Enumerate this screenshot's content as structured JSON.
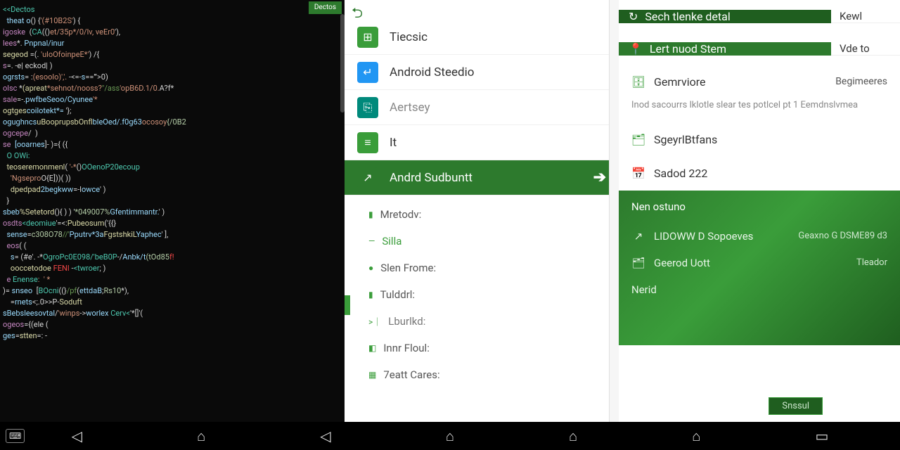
{
  "code": {
    "tab": "Dectos",
    "lines": [
      {
        "segs": [
          {
            "t": "<<Dectos",
            "c": "c-type"
          },
          {
            "t": " ",
            "c": ""
          }
        ]
      },
      {
        "segs": [
          {
            "t": "  theat o",
            "c": "c-var"
          },
          {
            "t": "() {",
            "c": "c-punc"
          },
          {
            "t": "'(#10B2S'",
            "c": "c-str"
          },
          {
            "t": ") {",
            "c": "c-punc"
          }
        ]
      },
      {
        "segs": [
          {
            "t": "igoske",
            "c": "c-kw"
          },
          {
            "t": "  (",
            "c": "c-punc"
          },
          {
            "t": "CA",
            "c": "c-type"
          },
          {
            "t": "(()",
            "c": "c-punc"
          },
          {
            "t": "et/35p*/0/lv, veEr0",
            "c": "c-str"
          },
          {
            "t": "'),",
            "c": "c-punc"
          }
        ]
      },
      {
        "segs": [
          {
            "t": "lees",
            "c": "c-kw"
          },
          {
            "t": "*. ",
            "c": "c-op"
          },
          {
            "t": "Pnpnal/inur",
            "c": "c-var"
          }
        ]
      },
      {
        "segs": [
          {
            "t": "segeod",
            "c": "c-fn"
          },
          {
            "t": " =(. ",
            "c": "c-op"
          },
          {
            "t": "'uloOfoinpeE*'",
            "c": "c-str"
          },
          {
            "t": ") /{",
            "c": "c-punc"
          }
        ]
      },
      {
        "segs": [
          {
            "t": "s",
            "c": "c-kw"
          },
          {
            "t": "=. -e| eckod| )",
            "c": "c-punc"
          }
        ]
      },
      {
        "segs": [
          {
            "t": "ogrsts",
            "c": "c-var"
          },
          {
            "t": "= :",
            "c": "c-op"
          },
          {
            "t": "(esoolo)','.",
            "c": "c-str"
          },
          {
            "t": " -<=-",
            "c": "c-op"
          },
          {
            "t": "s",
            "c": "c-var"
          },
          {
            "t": "=='''>0)",
            "c": "c-punc"
          }
        ]
      },
      {
        "segs": [
          {
            "t": "olsc",
            "c": "c-kw"
          },
          {
            "t": " *",
            "c": "c-op"
          },
          {
            "t": "(apreat",
            "c": "c-fn"
          },
          {
            "t": "*sehnot/nooss?",
            "c": "c-str"
          },
          {
            "t": "\"/ass",
            "c": "c-com"
          },
          {
            "t": "'opB6D.1/0.",
            "c": "c-str"
          },
          {
            "t": "A?",
            "c": "c-punc"
          },
          {
            "t": "f*",
            "c": "c-op"
          }
        ]
      },
      {
        "segs": [
          {
            "t": "sale",
            "c": "c-kw"
          },
          {
            "t": "=-.",
            "c": "c-op"
          },
          {
            "t": "pwfbeSeoo/Cyunee",
            "c": "c-var"
          },
          {
            "t": "'*",
            "c": "c-str"
          }
        ]
      },
      {
        "segs": [
          {
            "t": "ogtges",
            "c": "c-fn"
          },
          {
            "t": "coilotekt*=",
            "c": "c-var"
          },
          {
            "t": " '};",
            "c": "c-punc"
          }
        ]
      },
      {
        "segs": [
          {
            "t": "ogughncs",
            "c": "c-var"
          },
          {
            "t": "uBooprupsbOnf",
            "c": "c-fn"
          },
          {
            "t": "lbleOed/.f0g63",
            "c": "c-var"
          },
          {
            "t": "ocosoy",
            "c": "c-str"
          },
          {
            "t": "{/0B2",
            "c": "c-num"
          }
        ]
      },
      {
        "segs": [
          {
            "t": "ogcepe",
            "c": "c-kw"
          },
          {
            "t": "/  )",
            "c": "c-punc"
          }
        ]
      },
      {
        "segs": [
          {
            "t": "se",
            "c": "c-kw"
          },
          {
            "t": "  [ooarnes",
            "c": "c-var"
          },
          {
            "t": "]- )={ ({",
            "c": "c-punc"
          }
        ]
      },
      {
        "segs": [
          {
            "t": "  O OWi:",
            "c": "c-type"
          }
        ]
      },
      {
        "segs": [
          {
            "t": "  teoseremonmenl",
            "c": "c-fn"
          },
          {
            "t": "( ",
            "c": "c-punc"
          },
          {
            "t": "'-*",
            "c": "c-str"
          },
          {
            "t": "()",
            "c": "c-punc"
          },
          {
            "t": "OOenoP20ecoup",
            "c": "c-type"
          }
        ]
      },
      {
        "segs": [
          {
            "t": "    'Ngsepro",
            "c": "c-str"
          },
          {
            "t": "O{E]))( ))",
            "c": "c-punc"
          }
        ]
      },
      {
        "segs": [
          {
            "t": "    dpedpad",
            "c": "c-fn"
          },
          {
            "t": "2begkww",
            "c": "c-var"
          },
          {
            "t": "=-l",
            "c": "c-op"
          },
          {
            "t": "owce",
            "c": "c-var"
          },
          {
            "t": "' )",
            "c": "c-punc"
          }
        ]
      },
      {
        "segs": [
          {
            "t": "  }",
            "c": "c-punc"
          }
        ]
      },
      {
        "segs": [
          {
            "t": "sbeb",
            "c": "c-var"
          },
          {
            "t": "%Setetord",
            "c": "c-fn"
          },
          {
            "t": "(){ ) ) '",
            "c": "c-punc"
          },
          {
            "t": "*049007%",
            "c": "c-num"
          },
          {
            "t": "Gfentimmantr.",
            "c": "c-var"
          },
          {
            "t": "' )",
            "c": "c-punc"
          }
        ]
      },
      {
        "segs": [
          {
            "t": "osdts",
            "c": "c-kw"
          },
          {
            "t": "<deomiue",
            "c": "c-type"
          },
          {
            "t": "'=<:",
            "c": "c-op"
          },
          {
            "t": "Pubeosum",
            "c": "c-fn"
          },
          {
            "t": "('{{}",
            "c": "c-punc"
          }
        ]
      },
      {
        "segs": [
          {
            "t": "  sense",
            "c": "c-var"
          },
          {
            "t": "=",
            "c": "c-op"
          },
          {
            "t": "c308O78",
            "c": "c-num"
          },
          {
            "t": "//'",
            "c": "c-com"
          },
          {
            "t": "Pputrv*3a",
            "c": "c-var"
          },
          {
            "t": "FgstshkiL",
            "c": "c-fn"
          },
          {
            "t": "Yaphec",
            "c": "c-var"
          },
          {
            "t": "' ],",
            "c": "c-punc"
          }
        ]
      },
      {
        "segs": [
          {
            "t": "  eos",
            "c": "c-kw"
          },
          {
            "t": "( (",
            "c": "c-punc"
          }
        ]
      },
      {
        "segs": [
          {
            "t": "    s",
            "c": "c-var"
          },
          {
            "t": "= (#e",
            "c": "c-op"
          },
          {
            "t": "'. -",
            "c": "c-punc"
          },
          {
            "t": "*",
            "c": "c-op"
          },
          {
            "t": "OgroPc0E098/'beB0P",
            "c": "c-type"
          },
          {
            "t": "-/",
            "c": "c-op"
          },
          {
            "t": "Anbk/t",
            "c": "c-var"
          },
          {
            "t": "(tOd85",
            "c": "c-num"
          },
          {
            "t": "f!",
            "c": "c-err"
          }
        ]
      },
      {
        "segs": [
          {
            "t": "    ooccetodoe",
            "c": "c-fn"
          },
          {
            "t": " ",
            "c": ""
          },
          {
            "t": "FENI",
            "c": "c-err"
          },
          {
            "t": " -",
            "c": "c-op"
          },
          {
            "t": "<twroer",
            "c": "c-type"
          },
          {
            "t": "; )",
            "c": "c-punc"
          }
        ]
      },
      {
        "segs": [
          {
            "t": "  e ",
            "c": "c-kw"
          },
          {
            "t": "Enense",
            "c": "c-type"
          },
          {
            "t": ":  ' *",
            "c": "c-str"
          }
        ]
      },
      {
        "segs": [
          {
            "t": ")=",
            "c": "c-op"
          },
          {
            "t": " snseo",
            "c": "c-var"
          },
          {
            "t": "  [",
            "c": "c-punc"
          },
          {
            "t": "BOcni",
            "c": "c-type"
          },
          {
            "t": "((}",
            "c": "c-punc"
          },
          {
            "t": "/pf",
            "c": "c-com"
          },
          {
            "t": "(",
            "c": "c-punc"
          },
          {
            "t": "ettdaB",
            "c": "c-var"
          },
          {
            "t": ";",
            "c": "c-punc"
          },
          {
            "t": "Rs10",
            "c": "c-num"
          },
          {
            "t": "*),",
            "c": "c-punc"
          }
        ]
      },
      {
        "segs": [
          {
            "t": "    =",
            "c": "c-op"
          },
          {
            "t": "rnets",
            "c": "c-var"
          },
          {
            "t": "<;.0>>P-",
            "c": "c-op"
          },
          {
            "t": "Soduft",
            "c": "c-fn"
          }
        ]
      },
      {
        "segs": [
          {
            "t": "sBebsleesovtal",
            "c": "c-var"
          },
          {
            "t": "/",
            "c": "c-op"
          },
          {
            "t": "'winps",
            "c": "c-str"
          },
          {
            "t": "->",
            "c": "c-op"
          },
          {
            "t": "worlex",
            "c": "c-var"
          },
          {
            "t": " ",
            "c": ""
          },
          {
            "t": "Cerv<",
            "c": "c-type"
          },
          {
            "t": "'*[]",
            "c": "c-punc"
          },
          {
            "t": "'(",
            "c": "c-punc"
          }
        ]
      },
      {
        "segs": [
          {
            "t": "ogeos",
            "c": "c-kw"
          },
          {
            "t": "=",
            "c": "c-op"
          },
          {
            "t": "{(ele (",
            "c": "c-punc"
          }
        ]
      },
      {
        "segs": [
          {
            "t": "ges",
            "c": "c-var"
          },
          {
            "t": "=",
            "c": "c-op"
          },
          {
            "t": "stten",
            "c": "c-fn"
          },
          {
            "t": "=: -",
            "c": "c-op"
          }
        ]
      }
    ]
  },
  "menu": {
    "items": [
      {
        "icon": "ic-green",
        "glyph": "⊞",
        "label": "Tiecsic"
      },
      {
        "icon": "ic-blue",
        "glyph": "↵",
        "label": "Android Steedio"
      },
      {
        "icon": "ic-teal",
        "glyph": "⎘",
        "label": "Aertsey",
        "secondary": true
      },
      {
        "icon": "ic-green",
        "glyph": "≡",
        "label": "It"
      },
      {
        "icon": "ic-dark",
        "glyph": "↗",
        "label": "Andrd Sudbuntt",
        "selected": true
      }
    ],
    "subs": [
      {
        "glyph": "▮",
        "label": "Mretodv:",
        "cls": ""
      },
      {
        "glyph": "—",
        "label": "Silla",
        "cls": "silla"
      },
      {
        "glyph": "●",
        "label": "Slen Frome:",
        "cls": ""
      },
      {
        "glyph": "▮",
        "label": "Tulddrl:",
        "cls": ""
      },
      {
        "glyph": ">｜",
        "label": "Lburlkd:",
        "cls": "gray"
      },
      {
        "glyph": "◧",
        "label": "Innr Floul:",
        "cls": ""
      },
      {
        "glyph": "▦",
        "label": "7eatt Cares:",
        "cls": ""
      }
    ]
  },
  "detail": {
    "row1": {
      "icon": "↻",
      "label": "Sech tlenke detal",
      "right": "Kewl"
    },
    "row2": {
      "icon": "📍",
      "label": "Lert nuod Stem",
      "right": "Vde to"
    },
    "item1": {
      "icon": "🗄",
      "label": "Gemrviore",
      "right": "Begimeeres"
    },
    "desc": "Inod sacourrs lklotle slear tes potlcel pt 1 Eemdnslvmea",
    "item2": {
      "icon": "🗂",
      "label": "SgeyrlBtfans"
    },
    "item3": {
      "icon": "📅",
      "label": "Sadod 222"
    },
    "grad": {
      "title": "Nen ostuno",
      "r1": {
        "icon": "↗",
        "label": "LIDOWW D Sopoeves",
        "right": "Geaxno G DSME89 d3"
      },
      "r2": {
        "icon": "🗂",
        "label": "Geerod Uott",
        "right": "Tleador"
      },
      "r3": {
        "label": "Nerid"
      },
      "btn": "Snssul"
    }
  }
}
